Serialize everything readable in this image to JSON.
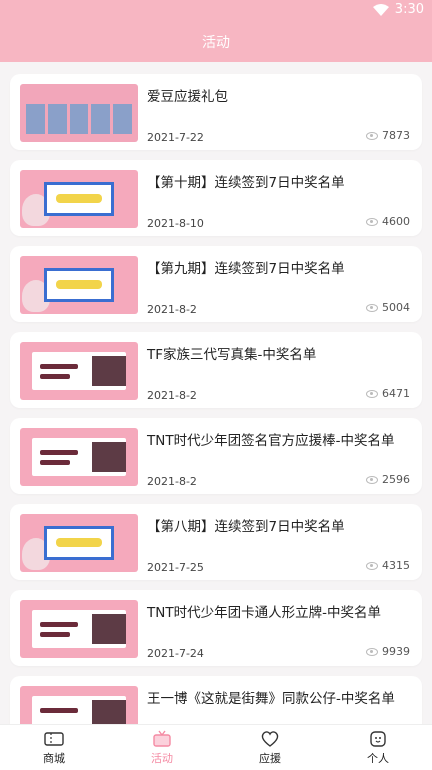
{
  "status": {
    "time": "3:30"
  },
  "header": {
    "title": "活动"
  },
  "items": [
    {
      "title": "爱豆应援礼包",
      "date": "2021-7-22",
      "views": "7873",
      "thumb": "grid"
    },
    {
      "title": "【第十期】连续签到7日中奖名单",
      "date": "2021-8-10",
      "views": "4600",
      "thumb": "signin"
    },
    {
      "title": "【第九期】连续签到7日中奖名单",
      "date": "2021-8-2",
      "views": "5004",
      "thumb": "signin"
    },
    {
      "title": "TF家族三代写真集-中奖名单",
      "date": "2021-8-2",
      "views": "6471",
      "thumb": "photo"
    },
    {
      "title": "TNT时代少年团签名官方应援棒-中奖名单",
      "date": "2021-8-2",
      "views": "2596",
      "thumb": "photo"
    },
    {
      "title": "【第八期】连续签到7日中奖名单",
      "date": "2021-7-25",
      "views": "4315",
      "thumb": "signin"
    },
    {
      "title": "TNT时代少年团卡通人形立牌-中奖名单",
      "date": "2021-7-24",
      "views": "9939",
      "thumb": "photo"
    },
    {
      "title": "王一博《这就是街舞》同款公仔-中奖名单",
      "date": "",
      "views": "",
      "thumb": "photo"
    }
  ],
  "tabs": [
    {
      "label": "商城",
      "icon": "ticket-icon"
    },
    {
      "label": "活动",
      "icon": "gift-icon"
    },
    {
      "label": "应援",
      "icon": "heart-icon"
    },
    {
      "label": "个人",
      "icon": "person-icon"
    }
  ],
  "colors": {
    "header": "#f7b6c2",
    "accent": "#f48aa3"
  }
}
